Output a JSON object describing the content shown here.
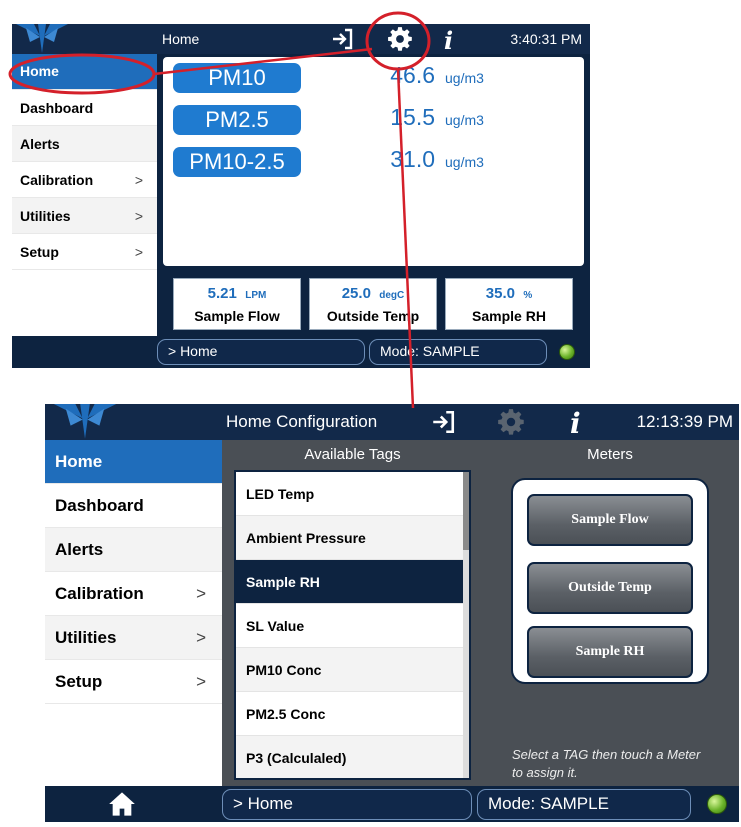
{
  "screen1": {
    "title": "Home",
    "clock": "3:40:31 PM",
    "icons": [
      "logo-icon",
      "exit-icon",
      "gear-icon",
      "info-icon"
    ],
    "menu": [
      {
        "label": "Home",
        "active": true
      },
      {
        "label": "Dashboard"
      },
      {
        "label": "Alerts"
      },
      {
        "label": "Calibration",
        "chevron": ">"
      },
      {
        "label": "Utilities",
        "chevron": ">"
      },
      {
        "label": "Setup",
        "chevron": ">"
      }
    ],
    "readings": [
      {
        "tag": "PM10",
        "value": "46.6",
        "unit": "ug/m3"
      },
      {
        "tag": "PM2.5",
        "value": "15.5",
        "unit": "ug/m3"
      },
      {
        "tag": "PM10-2.5",
        "value": "31.0",
        "unit": "ug/m3"
      }
    ],
    "meters": [
      {
        "value": "5.21",
        "unit": "LPM",
        "label": "Sample Flow"
      },
      {
        "value": "25.0",
        "unit": "degC",
        "label": "Outside Temp"
      },
      {
        "value": "35.0",
        "unit": "%",
        "label": "Sample RH"
      }
    ],
    "breadcrumb": "> Home",
    "mode": "Mode: SAMPLE"
  },
  "screen2": {
    "title": "Home Configuration",
    "clock": "12:13:39 PM",
    "icons": [
      "logo-icon",
      "exit-icon",
      "gear-icon",
      "info-icon",
      "home-icon"
    ],
    "menu": [
      {
        "label": "Home",
        "active": true
      },
      {
        "label": "Dashboard"
      },
      {
        "label": "Alerts"
      },
      {
        "label": "Calibration",
        "chevron": ">"
      },
      {
        "label": "Utilities",
        "chevron": ">"
      },
      {
        "label": "Setup",
        "chevron": ">"
      }
    ],
    "available_tags_header": "Available Tags",
    "meters_header": "Meters",
    "tags": [
      "LED Temp",
      "Ambient Pressure",
      "Sample RH",
      "SL Value",
      "PM10 Conc",
      "PM2.5 Conc",
      "P3 (Calculaled)"
    ],
    "selected_tag": "Sample RH",
    "meter_buttons": [
      "Sample Flow",
      "Outside Temp",
      "Sample RH"
    ],
    "hint": "Select a TAG then touch a Meter to assign it.",
    "breadcrumb": "> Home",
    "mode": "Mode: SAMPLE"
  },
  "colors": {
    "header": "#12294a",
    "active": "#1f6dbb",
    "tag_button": "#1f7bd0",
    "highlight": "#d4202a",
    "status_led": "#6bb32a"
  }
}
